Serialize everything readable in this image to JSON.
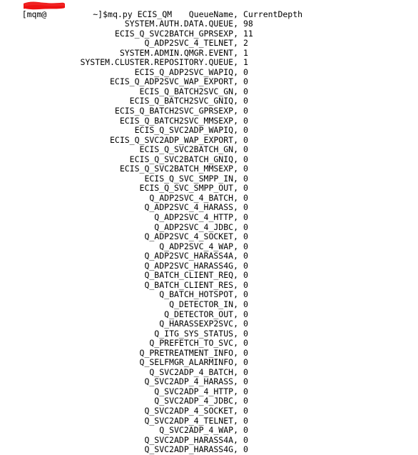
{
  "terminal": {
    "prompt": {
      "user_host_prefix": "[mqm@",
      "redacted_hostname": "",
      "path_suffix": " ~]$",
      "command": "mq.py ECIS_QM",
      "redaction_color": "#ee1111"
    },
    "columns": {
      "name_header": "QueueName,",
      "depth_header": "CurrentDepth"
    },
    "rows": [
      {
        "name": "SYSTEM.AUTH.DATA.QUEUE,",
        "depth": "98"
      },
      {
        "name": "ECIS_Q_SVC2BATCH_GPRSEXP,",
        "depth": "11"
      },
      {
        "name": "Q_ADP2SVC_4_TELNET,",
        "depth": "2"
      },
      {
        "name": "SYSTEM.ADMIN.QMGR.EVENT,",
        "depth": "1"
      },
      {
        "name": "SYSTEM.CLUSTER.REPOSITORY.QUEUE,",
        "depth": "1"
      },
      {
        "name": "ECIS_Q_ADP2SVC_WAPIQ,",
        "depth": "0"
      },
      {
        "name": "ECIS_Q_ADP2SVC_WAP_EXPORT,",
        "depth": "0"
      },
      {
        "name": "ECIS_Q_BATCH2SVC_GN,",
        "depth": "0"
      },
      {
        "name": "ECIS_Q_BATCH2SVC_GNIQ,",
        "depth": "0"
      },
      {
        "name": "ECIS_Q_BATCH2SVC_GPRSEXP,",
        "depth": "0"
      },
      {
        "name": "ECIS_Q_BATCH2SVC_MMSEXP,",
        "depth": "0"
      },
      {
        "name": "ECIS_Q_SVC2ADP_WAPIQ,",
        "depth": "0"
      },
      {
        "name": "ECIS_Q_SVC2ADP_WAP_EXPORT,",
        "depth": "0"
      },
      {
        "name": "ECIS_Q_SVC2BATCH_GN,",
        "depth": "0"
      },
      {
        "name": "ECIS_Q_SVC2BATCH_GNIQ,",
        "depth": "0"
      },
      {
        "name": "ECIS_Q_SVC2BATCH_MMSEXP,",
        "depth": "0"
      },
      {
        "name": "ECIS_Q_SVC_SMPP_IN,",
        "depth": "0"
      },
      {
        "name": "ECIS_Q_SVC_SMPP_OUT,",
        "depth": "0"
      },
      {
        "name": "Q_ADP2SVC_4_BATCH,",
        "depth": "0"
      },
      {
        "name": "Q_ADP2SVC_4_HARASS,",
        "depth": "0"
      },
      {
        "name": "Q_ADP2SVC_4_HTTP,",
        "depth": "0"
      },
      {
        "name": "Q_ADP2SVC_4_JDBC,",
        "depth": "0"
      },
      {
        "name": "Q_ADP2SVC_4_SOCKET,",
        "depth": "0"
      },
      {
        "name": "Q_ADP2SVC_4_WAP,",
        "depth": "0"
      },
      {
        "name": "Q_ADP2SVC_HARASS4A,",
        "depth": "0"
      },
      {
        "name": "Q_ADP2SVC_HARASS4G,",
        "depth": "0"
      },
      {
        "name": "Q_BATCH_CLIENT_REQ,",
        "depth": "0"
      },
      {
        "name": "Q_BATCH_CLIENT_RES,",
        "depth": "0"
      },
      {
        "name": "Q_BATCH_HOTSPOT,",
        "depth": "0"
      },
      {
        "name": "Q_DETECTOR_IN,",
        "depth": "0"
      },
      {
        "name": "Q_DETECTOR_OUT,",
        "depth": "0"
      },
      {
        "name": "Q_HARASSEXP2SVC,",
        "depth": "0"
      },
      {
        "name": "Q_ITG_SYS_STATUS,",
        "depth": "0"
      },
      {
        "name": "Q_PREFETCH_TO_SVC,",
        "depth": "0"
      },
      {
        "name": "Q_PRETREATMENT_INFO,",
        "depth": "0"
      },
      {
        "name": "Q_SELFMGR_ALARMINFO,",
        "depth": "0"
      },
      {
        "name": "Q_SVC2ADP_4_BATCH,",
        "depth": "0"
      },
      {
        "name": "Q_SVC2ADP_4_HARASS,",
        "depth": "0"
      },
      {
        "name": "Q_SVC2ADP_4_HTTP,",
        "depth": "0"
      },
      {
        "name": "Q_SVC2ADP_4_JDBC,",
        "depth": "0"
      },
      {
        "name": "Q_SVC2ADP_4_SOCKET,",
        "depth": "0"
      },
      {
        "name": "Q_SVC2ADP_4_TELNET,",
        "depth": "0"
      },
      {
        "name": "Q_SVC2ADP_4_WAP,",
        "depth": "0"
      },
      {
        "name": "Q_SVC2ADP_HARASS4A,",
        "depth": "0"
      },
      {
        "name": "Q_SVC2ADP_HARASS4G,",
        "depth": "0"
      }
    ]
  }
}
